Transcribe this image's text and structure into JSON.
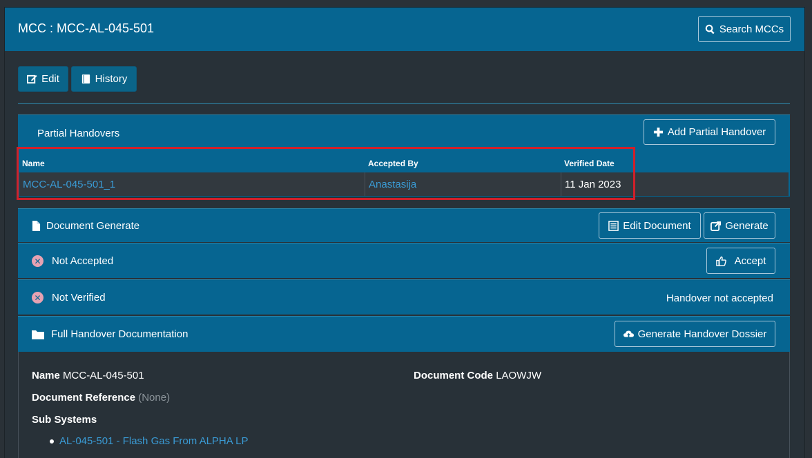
{
  "header": {
    "title": "MCC : MCC-AL-045-501",
    "search_label": "Search MCCs"
  },
  "toolbar": {
    "edit_label": "Edit",
    "history_label": "History"
  },
  "partial_handovers": {
    "title": "Partial Handovers",
    "add_label": "Add Partial Handover",
    "columns": [
      "Name",
      "Accepted By",
      "Verified Date"
    ],
    "rows": [
      {
        "name": "MCC-AL-045-501_1",
        "accepted_by": "Anastasija",
        "verified_date": "11 Jan 2023"
      }
    ]
  },
  "document_generate": {
    "title": "Document Generate",
    "edit_doc_label": "Edit Document",
    "generate_label": "Generate"
  },
  "not_accepted": {
    "title": "Not Accepted",
    "accept_label": "Accept"
  },
  "not_verified": {
    "title": "Not Verified",
    "status": "Handover not accepted"
  },
  "full_handover": {
    "title": "Full Handover Documentation",
    "dossier_label": "Generate Handover Dossier"
  },
  "details": {
    "name_label": "Name",
    "name_value": "MCC-AL-045-501",
    "doc_code_label": "Document Code",
    "doc_code_value": "LAOWJW",
    "doc_ref_label": "Document Reference",
    "doc_ref_value": "(None)",
    "sub_systems_label": "Sub Systems",
    "sub_systems": [
      "AL-045-501 - Flash Gas From ALPHA LP"
    ]
  },
  "colors": {
    "header_bg": "#066591",
    "page_bg": "#283138",
    "link": "#3a9bd5",
    "highlight": "#d0202a"
  }
}
